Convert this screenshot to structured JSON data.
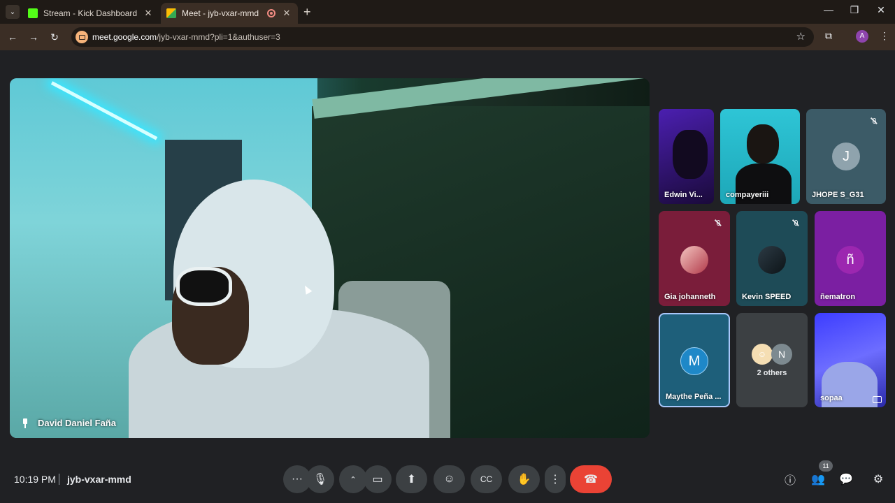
{
  "browser": {
    "tabs": [
      {
        "title": "Stream - Kick Dashboard",
        "favicon_color": "#53fc18",
        "active": false
      },
      {
        "title": "Meet - jyb-vxar-mmd",
        "favicon_color": "#34a853",
        "active": true
      }
    ],
    "url_host": "meet.google.com",
    "url_path": "/jyb-vxar-mmd?pli=1&authuser=3",
    "profile_initial": "A"
  },
  "meeting": {
    "time": "10:19 PM",
    "code": "jyb-vxar-mmd",
    "main_speaker": "David Daniel Faña",
    "participant_count": "11"
  },
  "tiles": [
    {
      "name": "Edwin Vi...",
      "type": "video",
      "muted": false
    },
    {
      "name": "compayeriii",
      "type": "video",
      "muted": false
    },
    {
      "name": "JHOPE S_G31",
      "type": "avatar",
      "initial": "J",
      "muted": true
    },
    {
      "name": "Gia johanneth",
      "type": "avatar-image",
      "muted": true
    },
    {
      "name": "Kevin SPEED",
      "type": "avatar-image",
      "muted": true
    },
    {
      "name": "ñematron",
      "type": "avatar",
      "initial": "ñ",
      "muted": false
    },
    {
      "name": "Maythe Peña ...",
      "type": "avatar",
      "initial": "M",
      "muted": false
    },
    {
      "name": "2 others",
      "type": "group",
      "initial": "N",
      "muted": false
    },
    {
      "name": "sopaa",
      "type": "video",
      "muted": false
    }
  ],
  "colors": {
    "end_call": "#ea4335",
    "tile_purple": "#7b1fa2",
    "tile_teal": "#1e4b57",
    "tile_maroon": "#7a1d3a",
    "tile_slate": "#3c5b67",
    "tile_blue_avatar": "#1e88c8"
  }
}
